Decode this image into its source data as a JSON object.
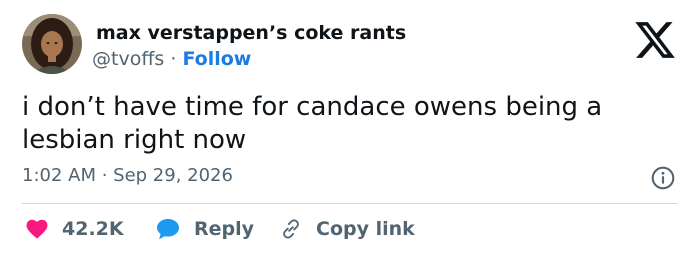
{
  "tweet": {
    "author_name": "max verstappen’s coke rants",
    "handle": "@tvoffs",
    "separator": "·",
    "follow_label": "Follow",
    "text": "i don’t have time for candace owens being a lesbian right now",
    "timestamp": "1:02 AM · Sep 29, 2026"
  },
  "actions": {
    "likes_count": "42.2K",
    "reply_label": "Reply",
    "copy_link_label": "Copy link"
  },
  "icons": {
    "brand": "x-logo-icon",
    "info": "info-icon",
    "like": "heart-icon",
    "reply": "speech-bubble-icon",
    "copy": "link-icon"
  },
  "colors": {
    "text": "#0f1419",
    "secondary": "#536471",
    "follow": "#1d7ce0",
    "heart": "#f91880",
    "reply_bubble": "#1d9bf0",
    "divider": "#cfd9de"
  }
}
